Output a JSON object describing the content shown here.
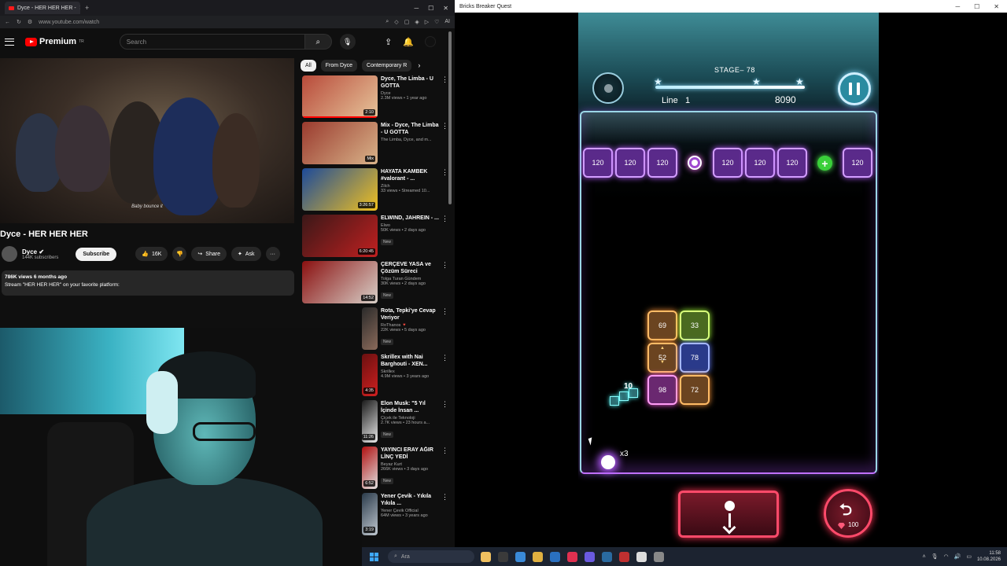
{
  "browser": {
    "tab_title": "Dyce - HER HER HER -",
    "tab_close": "✕",
    "new_tab": "+",
    "url": "www.youtube.com/watch",
    "ext_ai": "AI"
  },
  "youtube": {
    "logo": "Premium",
    "logo_sup": "TR",
    "search_placeholder": "Search",
    "video_caption": "Baby bounce it",
    "video_title": "Dyce - HER HER HER",
    "channel_name": "Dyce",
    "channel_subs": "144K subscribers",
    "subscribe_label": "Subscribe",
    "like_count": "16K",
    "share_label": "Share",
    "ask_label": "Ask",
    "more_label": "···",
    "description_meta": "786K views  6 months ago",
    "description_text": "Stream \"HER HER HER\" on your favorite platform:",
    "chips": [
      "All",
      "From Dyce",
      "Contemporary R"
    ],
    "recommendations": [
      {
        "title": "Dyce, The Limba - U GOTTA",
        "channel": "Dyce",
        "meta": "2.3M views • 1 year ago",
        "duration": "2:10",
        "new": "",
        "colors": [
          "#b84a3a",
          "#e6c49a"
        ]
      },
      {
        "title": "Mix - Dyce, The Limba - U GOTTA",
        "channel": "The Limba, Dyce, and m...",
        "meta": "",
        "duration": "Mix",
        "new": "",
        "colors": [
          "#9a3a2e",
          "#d9b48a"
        ]
      },
      {
        "title": "HAYATA KAMBEK #valorant ‐ ...",
        "channel": "Zilch",
        "meta": "33 views • Streamed 10...",
        "duration": "3:26:57",
        "new": "",
        "colors": [
          "#1c4a9a",
          "#f0c020"
        ]
      },
      {
        "title": "ELWIND, JAHREIN ‐ ...",
        "channel": "Elwo",
        "meta": "50K views • 2 days ago",
        "duration": "6:20:45",
        "new": "New",
        "colors": [
          "#3a1818",
          "#c02020"
        ]
      },
      {
        "title": "ÇERÇEVE YASA ve Çözüm Süreci",
        "channel": "Tolga Turan Gündem",
        "meta": "30K views • 2 days ago",
        "duration": "14:52",
        "new": "New",
        "colors": [
          "#8a1010",
          "#d8d0c8"
        ]
      },
      {
        "title": "Rota, Tepki'ye Cevap Veriyor",
        "channel": "RoThanos 🔻",
        "meta": "22K views • 5 days ago",
        "duration": "",
        "new": "New",
        "colors": [
          "#2a2a2a",
          "#8a6a5a"
        ]
      },
      {
        "title": "Skrillex with Nai Barghouti ‐ XEN...",
        "channel": "Skrillex",
        "meta": "4.9M views • 3 years ago",
        "duration": "4:35",
        "new": "",
        "colors": [
          "#6a1010",
          "#d02020"
        ]
      },
      {
        "title": "Elon Musk: \"5 Yıl İçinde İnsan ...",
        "channel": "Çiçek ile Teknoloji",
        "meta": "2.7K views • 23 hours a...",
        "duration": "11:26",
        "new": "New",
        "colors": [
          "#1a1a1a",
          "#e8e8e8"
        ]
      },
      {
        "title": "YAYINCI ERAY AĞIR LİNÇ YEDİ",
        "channel": "Beyaz Kurt",
        "meta": "266K views • 3 days ago",
        "duration": "6:52",
        "new": "New",
        "colors": [
          "#b01010",
          "#e0e0e0"
        ]
      },
      {
        "title": "Yener Çevik - Yıkıla Yıkıla ...",
        "channel": "Yener Çevik Official",
        "meta": "64M views • 3 years ago",
        "duration": "3:19",
        "new": "",
        "colors": [
          "#2a3a4a",
          "#c0c8d0"
        ]
      }
    ]
  },
  "game_window": {
    "title": "Bricks Breaker Quest",
    "stage_label": "STAGE‒ 78",
    "line_label": "Line",
    "line_value": "1",
    "score": "8090",
    "stage_stars": 3,
    "top_row": [
      "120",
      "120",
      "120",
      "120",
      "120",
      "120",
      "120"
    ],
    "cluster": [
      {
        "value": "69",
        "color": "orange"
      },
      {
        "value": "33",
        "color": "green"
      },
      {
        "value": "52",
        "color": "orange"
      },
      {
        "value": "78",
        "color": "blue"
      },
      {
        "value": "98",
        "color": "magenta"
      },
      {
        "value": "72",
        "color": "orange"
      }
    ],
    "launcher_count": "10",
    "balls_count": "x3",
    "undo_cost": "100"
  },
  "taskbar": {
    "search_placeholder": "Ara",
    "clock_time": "11:58",
    "clock_date": "10.08.2026",
    "apps": [
      "#f0c060",
      "#3a3a3a",
      "#3a8ad8",
      "#e0b040",
      "#2a70c0",
      "#e03050",
      "#6a5ae0",
      "#2a6aa0",
      "#c03030",
      "#ddd",
      "#888"
    ]
  },
  "colors": {
    "yt_red": "#ff0000",
    "brick_purple": "#d29cff",
    "brick_orange": "#ffbb66",
    "brick_green": "#d8ff7a",
    "brick_blue": "#a6b8ff",
    "brick_magenta": "#ff9cf6",
    "button_red": "#ff4a6a"
  }
}
